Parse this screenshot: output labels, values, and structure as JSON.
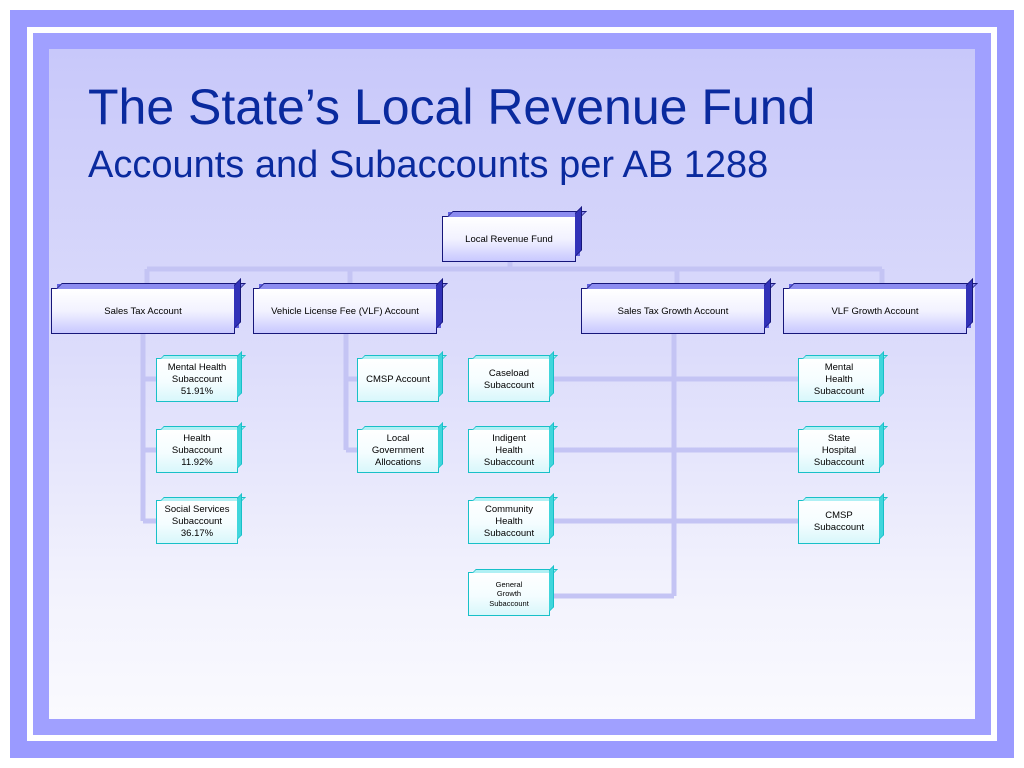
{
  "title": "The State’s Local Revenue Fund",
  "subtitle": "Accounts and Subaccounts per AB 1288",
  "root": "Local Revenue Fund",
  "accounts": [
    "Sales Tax Account",
    "Vehicle License Fee (VLF) Account",
    "Sales Tax Growth Account",
    "VLF Growth Account"
  ],
  "subaccounts": {
    "mental_health": "Mental Health\nSubaccount\n51.91%",
    "health": "Health\nSubaccount\n11.92%",
    "social_services": "Social Services\nSubaccount\n36.17%",
    "cmsp_account": "CMSP Account",
    "local_gov_alloc": "Local\nGovernment\nAllocations",
    "caseload": "Caseload\nSubaccount",
    "indigent_health": "Indigent\nHealth\nSubaccount",
    "community_health": "Community\nHealth\nSubaccount",
    "general_growth": "General\nGrowth\nSubaccount",
    "vlf_mental_health": "Mental\nHealth\nSubaccount",
    "state_hospital": "State\nHospital\nSubaccount",
    "vlf_cmsp": "CMSP\nSubaccount"
  },
  "colors": {
    "title": "#0a2a9e",
    "frame": "#9a9aff",
    "connector": "#c4c4f4",
    "account_border": "#16167a",
    "subaccount_border": "#18c0c8"
  }
}
